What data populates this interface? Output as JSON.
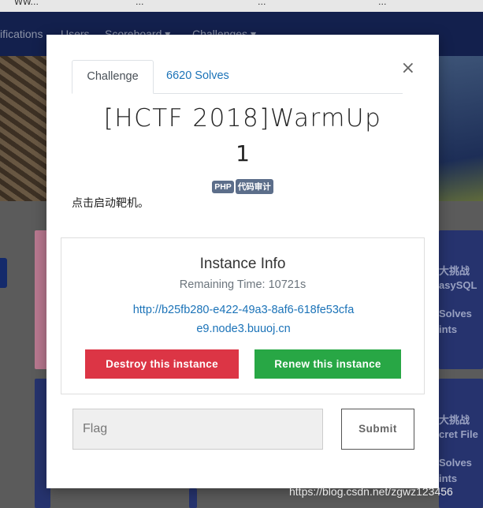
{
  "background": {
    "tabbar": [
      "WW...",
      "...",
      "...",
      "..."
    ],
    "nav": [
      "ifications",
      "Users",
      "Scoreboard ▾",
      "Challenges ▾"
    ],
    "cards": [
      {
        "lines": [
          "大挑战",
          "asySQL",
          "Solves",
          "ints"
        ]
      },
      {
        "lines": [
          "大挑战",
          "cret File",
          "Solves",
          "ints"
        ]
      }
    ]
  },
  "modal": {
    "tabs": {
      "challenge": "Challenge",
      "solves": "6620 Solves"
    },
    "close_glyph": "×",
    "title": "[HCTF 2018]WarmUp",
    "value": "1",
    "tags": [
      "PHP",
      "代码审计"
    ],
    "description": "点击启动靶机。",
    "instance": {
      "title": "Instance Info",
      "remaining": "Remaining Time: 10721s",
      "url": "http://b25fb280-e422-49a3-8af6-618fe53cfae9.node3.buuoj.cn",
      "destroy_label": "Destroy this instance",
      "renew_label": "Renew this instance"
    },
    "flag_placeholder": "Flag",
    "submit_label": "Submit"
  },
  "watermark": "https://blog.csdn.net/zgwz123456",
  "colors": {
    "destroy": "#dc3545",
    "renew": "#28a745",
    "link": "#1b73b8",
    "nav": "#13204d",
    "tag": "#5c6e8a"
  }
}
